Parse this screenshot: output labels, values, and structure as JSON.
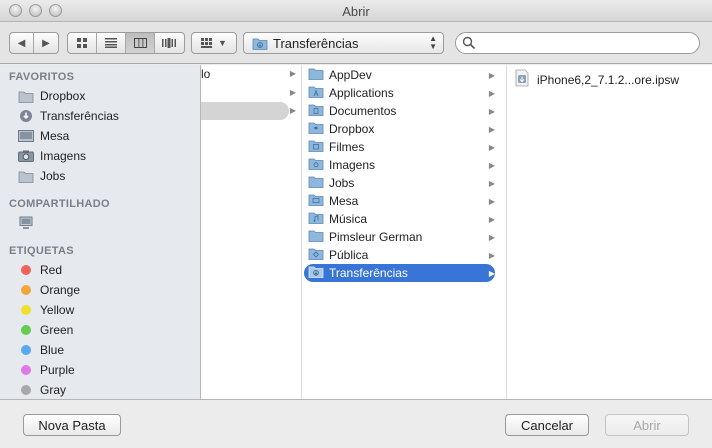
{
  "window": {
    "title": "Abrir"
  },
  "toolbar": {
    "path_label": "Transferências",
    "search_placeholder": ""
  },
  "sidebar": {
    "favorites_header": "FAVORITOS",
    "favorites": [
      {
        "label": "Dropbox",
        "icon": "folder-icon"
      },
      {
        "label": "Transferências",
        "icon": "downloads-icon"
      },
      {
        "label": "Mesa",
        "icon": "desktop-icon"
      },
      {
        "label": "Imagens",
        "icon": "camera-icon"
      },
      {
        "label": "Jobs",
        "icon": "folder-icon"
      }
    ],
    "shared_header": "COMPARTILHADO",
    "tags_header": "ETIQUETAS",
    "tags": [
      {
        "label": "Red",
        "color": "#f0625c"
      },
      {
        "label": "Orange",
        "color": "#f5a43b"
      },
      {
        "label": "Yellow",
        "color": "#f0e02e"
      },
      {
        "label": "Green",
        "color": "#64cc4e"
      },
      {
        "label": "Blue",
        "color": "#59a8f2"
      },
      {
        "label": "Purple",
        "color": "#e079e8"
      },
      {
        "label": "Gray",
        "color": "#a8a8a8"
      }
    ]
  },
  "column1": {
    "truncated_text": "lo"
  },
  "column2": {
    "items": [
      {
        "label": "AppDev",
        "selected": false
      },
      {
        "label": "Applications",
        "selected": false
      },
      {
        "label": "Documentos",
        "selected": false
      },
      {
        "label": "Dropbox",
        "selected": false
      },
      {
        "label": "Filmes",
        "selected": false
      },
      {
        "label": "Imagens",
        "selected": false
      },
      {
        "label": "Jobs",
        "selected": false
      },
      {
        "label": "Mesa",
        "selected": false
      },
      {
        "label": "Música",
        "selected": false
      },
      {
        "label": "Pimsleur German",
        "selected": false
      },
      {
        "label": "Pública",
        "selected": false
      },
      {
        "label": "Transferências",
        "selected": true
      }
    ]
  },
  "column3": {
    "file": "iPhone6,2_7.1.2...ore.ipsw"
  },
  "bottom": {
    "new_folder": "Nova Pasta",
    "cancel": "Cancelar",
    "open": "Abrir"
  }
}
